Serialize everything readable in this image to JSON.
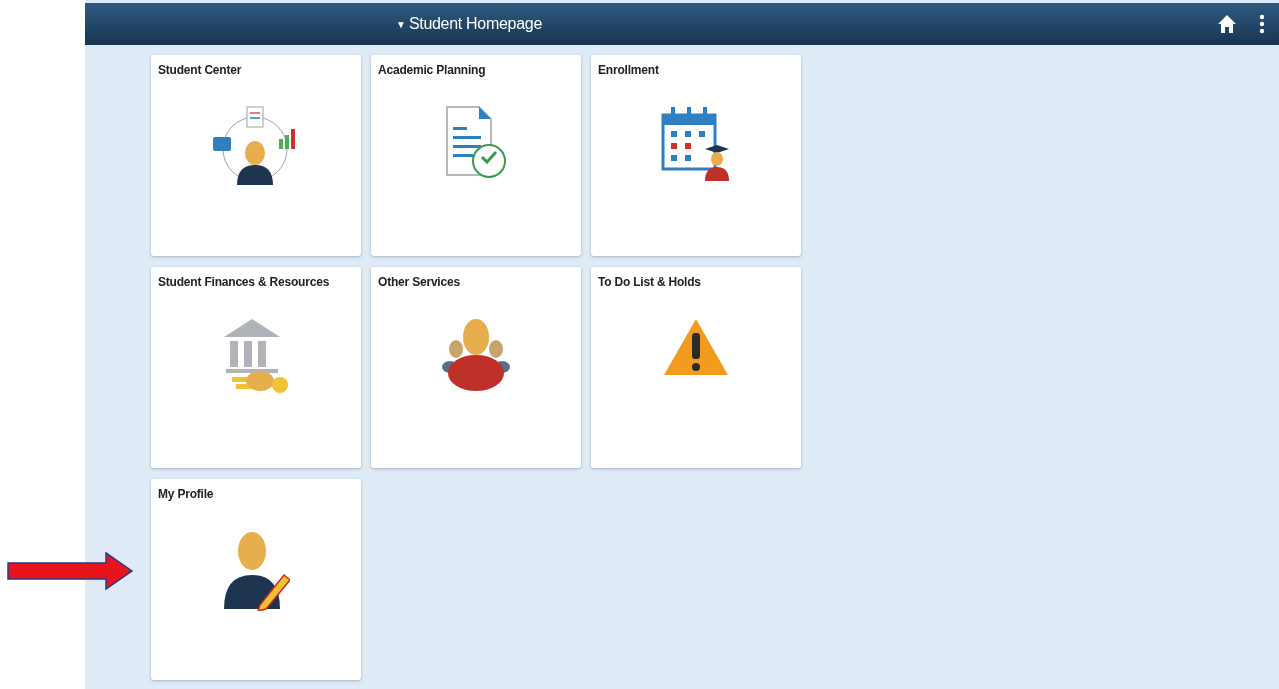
{
  "header": {
    "caret": "▼",
    "title": "Student Homepage"
  },
  "tiles": [
    {
      "label": "Student Center",
      "kind": "center"
    },
    {
      "label": "Academic Planning",
      "kind": "planning"
    },
    {
      "label": "Enrollment",
      "kind": "calendar"
    },
    {
      "label": "Student Finances & Resources",
      "kind": "bank"
    },
    {
      "label": "Other Services",
      "kind": "group"
    },
    {
      "label": "To Do List & Holds",
      "kind": "warning"
    },
    {
      "label": "My Profile",
      "kind": "profile"
    }
  ]
}
